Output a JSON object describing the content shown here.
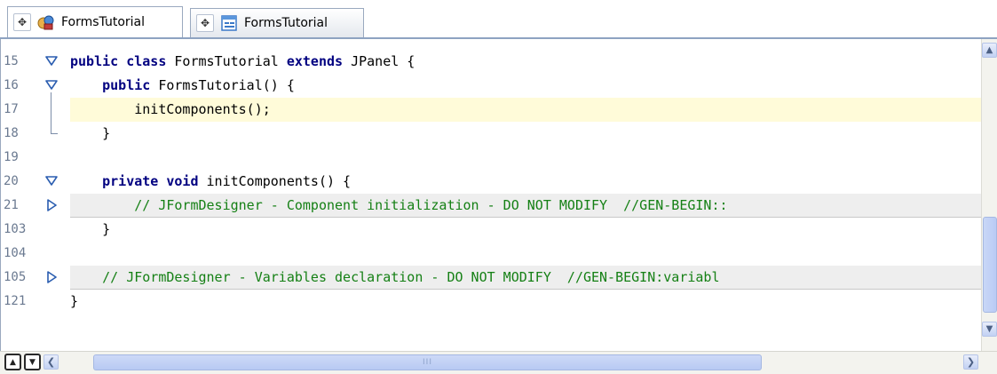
{
  "tabs": [
    {
      "label": "FormsTutorial",
      "icon": "java-bean-icon",
      "active": true
    },
    {
      "label": "FormsTutorial",
      "icon": "form-designer-icon",
      "active": false
    }
  ],
  "editor": {
    "lines": [
      {
        "num": "15",
        "fold": "expanded",
        "parts": [
          [
            "kw",
            "public class "
          ],
          [
            "",
            "FormsTutorial "
          ],
          [
            "kw",
            "extends "
          ],
          [
            "",
            "JPanel {"
          ]
        ]
      },
      {
        "num": "16",
        "fold": "expanded",
        "parts": [
          [
            "",
            "    "
          ],
          [
            "kw",
            "public "
          ],
          [
            "",
            "FormsTutorial() {"
          ]
        ]
      },
      {
        "num": "17",
        "fold": "none",
        "highlight": true,
        "parts": [
          [
            "",
            "        initComponents();"
          ]
        ]
      },
      {
        "num": "18",
        "fold": "none",
        "parts": [
          [
            "",
            "    }"
          ]
        ]
      },
      {
        "num": "19",
        "fold": "none",
        "parts": []
      },
      {
        "num": "20",
        "fold": "expanded",
        "parts": [
          [
            "",
            "    "
          ],
          [
            "kw",
            "private void "
          ],
          [
            "",
            "initComponents() {"
          ]
        ]
      },
      {
        "num": "21",
        "fold": "collapsed",
        "folded": true,
        "parts": [
          [
            "cm",
            "        // JFormDesigner - Component initialization - DO NOT MODIFY  //GEN-BEGIN::"
          ]
        ]
      },
      {
        "num": "103",
        "fold": "none",
        "parts": [
          [
            "",
            "    }"
          ]
        ]
      },
      {
        "num": "104",
        "fold": "none",
        "parts": []
      },
      {
        "num": "105",
        "fold": "collapsed",
        "folded": true,
        "parts": [
          [
            "cm",
            "    // JFormDesigner - Variables declaration - DO NOT MODIFY  //GEN-BEGIN:variabl"
          ]
        ]
      },
      {
        "num": "121",
        "fold": "none",
        "parts": [
          [
            "",
            "}"
          ]
        ]
      }
    ]
  },
  "scrollbars": {
    "vertical": {
      "up_icon": "scroll-up-arrow-icon",
      "down_icon": "scroll-down-arrow-icon"
    },
    "horizontal": {
      "left_icon": "scroll-left-arrow-icon",
      "right_icon": "scroll-right-arrow-icon",
      "thumb_grip": "III"
    }
  },
  "navigation": {
    "prev_icon": "previous-occurrence-icon",
    "next_icon": "next-occurrence-icon"
  }
}
